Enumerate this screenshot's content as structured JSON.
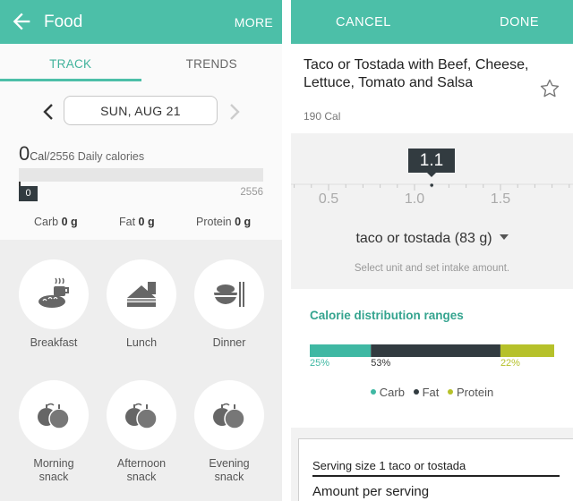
{
  "left": {
    "appbar": {
      "title": "Food",
      "more": "MORE",
      "back_icon": "arrow-left-icon"
    },
    "tabs": [
      {
        "label": "TRACK",
        "active": true
      },
      {
        "label": "TRENDS",
        "active": false
      }
    ],
    "date": {
      "label": "SUN, AUG 21",
      "prev_icon": "chevron-left-icon",
      "next_icon": "chevron-right-icon"
    },
    "calories": {
      "consumed": "0",
      "unit": "Cal",
      "goal_text": "/2556 Daily calories",
      "progress_badge": "0",
      "max_label": "2556",
      "progress_fraction": 0
    },
    "macros": [
      {
        "label": "Carb",
        "value": "0 g"
      },
      {
        "label": "Fat",
        "value": "0 g"
      },
      {
        "label": "Protein",
        "value": "0 g"
      }
    ],
    "meals": [
      {
        "label": "Breakfast",
        "icon": "breakfast-coffee-bread-icon"
      },
      {
        "label": "Lunch",
        "icon": "lunch-sandwich-icon"
      },
      {
        "label": "Dinner",
        "icon": "dinner-bowl-chopsticks-icon"
      },
      {
        "label": "Morning\nsnack",
        "icon": "apple-snack-icon"
      },
      {
        "label": "Afternoon\nsnack",
        "icon": "apple-snack-icon"
      },
      {
        "label": "Evening\nsnack",
        "icon": "apple-snack-icon"
      }
    ]
  },
  "right": {
    "appbar": {
      "cancel": "CANCEL",
      "done": "DONE"
    },
    "food": {
      "name": "Taco or Tostada with Beef, Cheese, Lettuce, Tomato and Salsa",
      "calories": "190 Cal",
      "favorite_icon": "star-outline-icon"
    },
    "amount": {
      "value": "1.1",
      "ticks": [
        "0.5",
        "1.0",
        "1.5"
      ],
      "unit": "taco or tostada (83 g)",
      "hint": "Select unit and set intake amount."
    },
    "distribution": {
      "title": "Calorie distribution ranges",
      "segments": [
        {
          "name": "Carb",
          "percent": 25,
          "label": "25%",
          "color": "#3fb8a3"
        },
        {
          "name": "Fat",
          "percent": 53,
          "label": "53%",
          "color": "#323b40"
        },
        {
          "name": "Protein",
          "percent": 22,
          "label": "22%",
          "color": "#b6c12a"
        }
      ]
    },
    "nutrition": {
      "serving_size": "Serving size 1 taco or tostada",
      "amount_per_serving": "Amount per serving"
    }
  },
  "colors": {
    "accent": "#4cbfa8",
    "dark": "#323b40",
    "protein": "#b6c12a"
  }
}
